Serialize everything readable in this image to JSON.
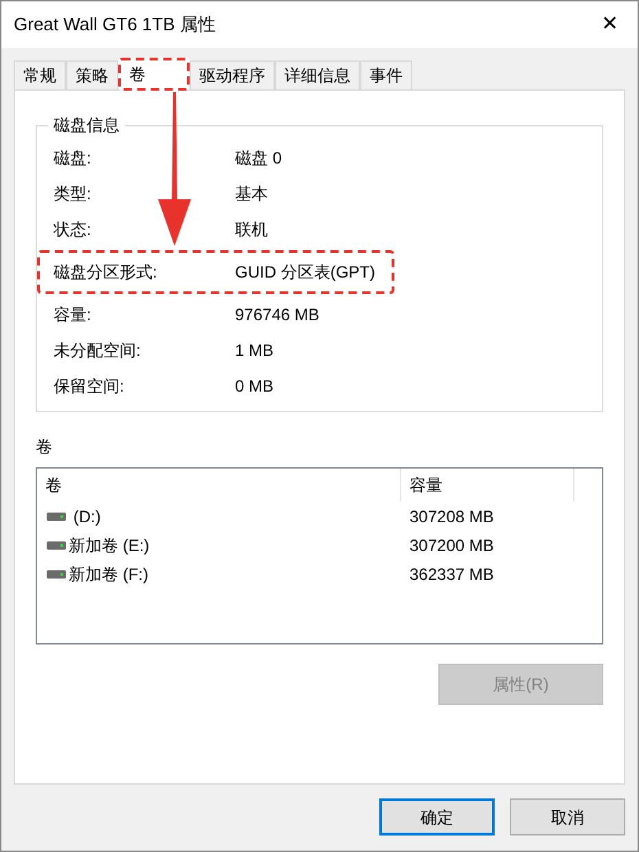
{
  "window": {
    "title": "Great Wall GT6 1TB 属性",
    "close": "✕"
  },
  "tabs": [
    {
      "label": "常规",
      "selected": false,
      "annotated": false
    },
    {
      "label": "策略",
      "selected": false,
      "annotated": false
    },
    {
      "label": "卷",
      "selected": true,
      "annotated": true
    },
    {
      "label": "驱动程序",
      "selected": false,
      "annotated": false
    },
    {
      "label": "详细信息",
      "selected": false,
      "annotated": false
    },
    {
      "label": "事件",
      "selected": false,
      "annotated": false
    }
  ],
  "disk_info": {
    "title": "磁盘信息",
    "rows": [
      {
        "label": "磁盘:",
        "value": "磁盘 0",
        "annotated": false
      },
      {
        "label": "类型:",
        "value": "基本",
        "annotated": false
      },
      {
        "label": "状态:",
        "value": "联机",
        "annotated": false
      },
      {
        "label": "磁盘分区形式:",
        "value": "GUID 分区表(GPT)",
        "annotated": true
      },
      {
        "label": "容量:",
        "value": "976746 MB",
        "annotated": false
      },
      {
        "label": "未分配空间:",
        "value": "1 MB",
        "annotated": false
      },
      {
        "label": "保留空间:",
        "value": "0 MB",
        "annotated": false
      }
    ]
  },
  "volumes": {
    "title": "卷",
    "columns": [
      "卷",
      "容量"
    ],
    "rows": [
      {
        "name": " (D:)",
        "capacity": "307208 MB"
      },
      {
        "name": "新加卷 (E:)",
        "capacity": "307200 MB"
      },
      {
        "name": "新加卷 (F:)",
        "capacity": "362337 MB"
      }
    ],
    "properties_button": {
      "label": "属性(R)",
      "disabled": true
    }
  },
  "buttons": [
    {
      "label": "确定",
      "default": true
    },
    {
      "label": "取消",
      "default": false
    }
  ]
}
